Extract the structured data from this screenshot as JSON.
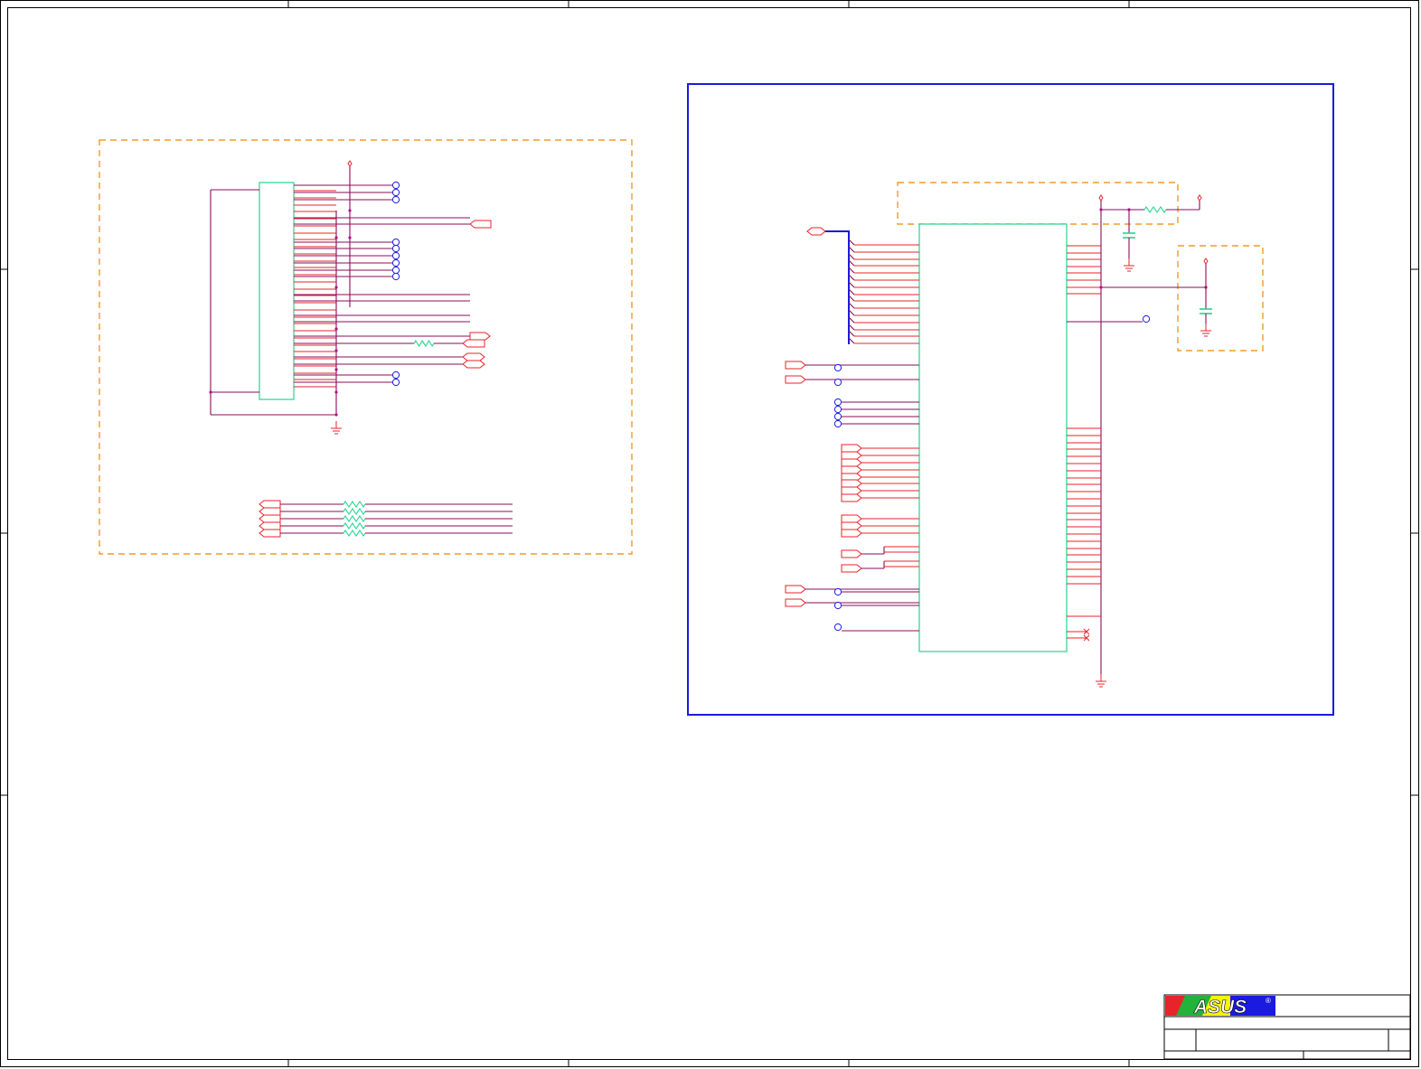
{
  "title_block": {
    "logo_text": "ASUS",
    "registered_mark": "®"
  },
  "colors": {
    "pin": "#e8232a",
    "wire": "#8a0c5a",
    "bus": "#1a1ae0",
    "part_outline": "#22d68f",
    "group_dash": "#f39a2a",
    "test_point": "#1a1ae0",
    "logo_red": "#e8232a",
    "logo_blue": "#1a1ae0"
  },
  "icons": [
    "ground-icon",
    "power-rail-icon",
    "test-point-icon",
    "net-port-icon",
    "resistor-icon",
    "capacitor-icon",
    "no-connect-icon",
    "registered-icon"
  ]
}
